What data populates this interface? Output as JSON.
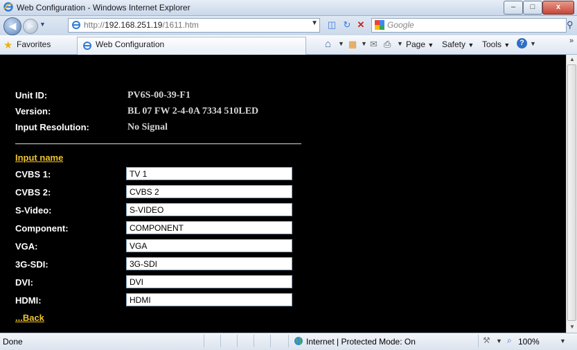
{
  "window": {
    "title": "Web Configuration - Windows Internet Explorer"
  },
  "address": {
    "url_prefix": "http://",
    "url_host": "192.168.251.19",
    "url_path": "/1611.htm"
  },
  "search": {
    "placeholder": "Google"
  },
  "favorites": {
    "label": "Favorites"
  },
  "tab": {
    "label": "Web Configuration"
  },
  "commands": {
    "page": "Page",
    "safety": "Safety",
    "tools": "Tools"
  },
  "info": {
    "unit_id_label": "Unit ID:",
    "unit_id_value": "PV6S-00-39-F1",
    "version_label": "Version:",
    "version_value": "BL 07 FW 2-4-0A 7334 510LED",
    "resolution_label": "Input Resolution:",
    "resolution_value": "No Signal"
  },
  "section": {
    "input_name_link": "Input name",
    "back_link": "...Back"
  },
  "inputs": [
    {
      "label": "CVBS 1:",
      "value": "TV 1"
    },
    {
      "label": "CVBS 2:",
      "value": "CVBS 2"
    },
    {
      "label": "S-Video:",
      "value": "S-VIDEO"
    },
    {
      "label": "Component:",
      "value": "COMPONENT"
    },
    {
      "label": "VGA:",
      "value": "VGA"
    },
    {
      "label": "3G-SDI:",
      "value": "3G-SDI"
    },
    {
      "label": "DVI:",
      "value": "DVI"
    },
    {
      "label": "HDMI:",
      "value": "HDMI"
    }
  ],
  "statusbar": {
    "left": "Done",
    "zone": "Internet | Protected Mode: On",
    "zoom": "100%"
  },
  "colors": {
    "content_bg": "#000000",
    "link": "#f0c32d",
    "label": "#ffffff",
    "value": "#d6d6d6"
  }
}
